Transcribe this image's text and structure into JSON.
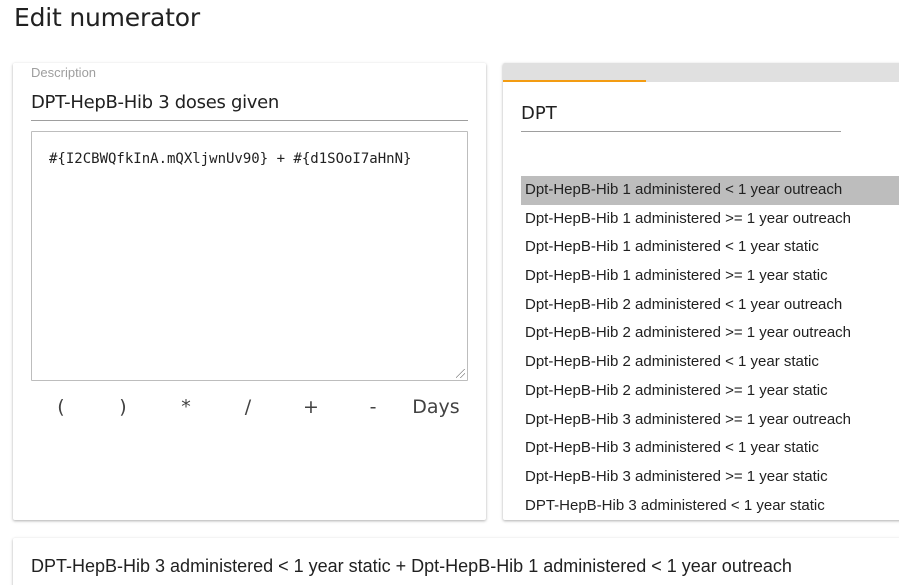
{
  "page": {
    "title": "Edit numerator"
  },
  "left_panel": {
    "description_label": "Description",
    "description_value": "DPT-HepB-Hib 3 doses given",
    "formula": "#{I2CBWQfkInA.mQXljwnUv90} + #{d1SOoI7aHnN}",
    "operators": [
      "(",
      ")",
      "*",
      "/",
      "+",
      "-",
      "Days"
    ]
  },
  "right_panel": {
    "search_value": "DPT",
    "options": [
      "Dpt-HepB-Hib 1 administered < 1 year outreach",
      "Dpt-HepB-Hib 1 administered >= 1 year outreach",
      "Dpt-HepB-Hib 1 administered < 1 year static",
      "Dpt-HepB-Hib 1 administered >= 1 year static",
      "Dpt-HepB-Hib 2 administered < 1 year outreach",
      "Dpt-HepB-Hib 2 administered >= 1 year outreach",
      "Dpt-HepB-Hib 2 administered < 1 year static",
      "Dpt-HepB-Hib 2 administered >= 1 year static",
      "Dpt-HepB-Hib 3 administered >= 1 year outreach",
      "Dpt-HepB-Hib 3 administered < 1 year static",
      "Dpt-HepB-Hib 3 administered >= 1 year static",
      "DPT-HepB-Hib 3 administered < 1 year static"
    ],
    "selected_option": "Dpt-HepB-Hib 1 administered < 1 year outreach"
  },
  "bottom_panel": {
    "formula_preview": "DPT-HepB-Hib 3 administered < 1 year static + Dpt-HepB-Hib 1 administered < 1 year outreach"
  },
  "colors": {
    "accent": "#f39c12",
    "selected_bg": "#bdbdbd",
    "tab_bar": "#e0e0e0"
  }
}
